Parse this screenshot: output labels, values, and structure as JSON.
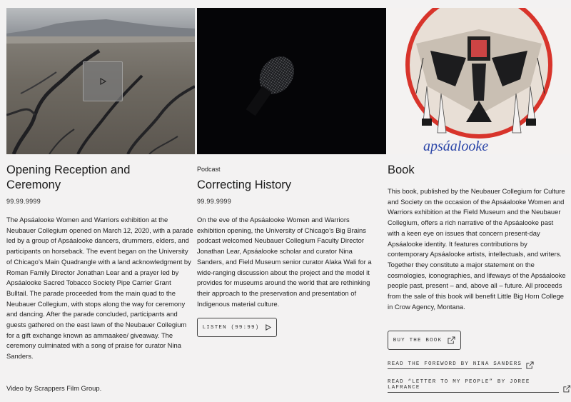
{
  "items": [
    {
      "title": "Opening Reception and Ceremony",
      "date": "99.99.9999",
      "body": "The Apsáalooke Women and Warriors exhibition at the Neubauer Collegium opened on March 12, 2020, with a parade led by a group of Apsáalooke dancers, drummers, elders, and participants on horseback. The event began on the University of Chicago’s Main Quadrangle with a land acknowledgment by Roman Family Director Jonathan Lear and a prayer led by Apsáalooke Sacred Tobacco Society Pipe Carrier Grant Bulltail. The parade proceeded from the main quad to the Neubauer Collegium, with stops along the way for ceremony and dancing. After the parade concluded, participants and guests gathered on the east lawn of the Neubauer Collegium for a gift exchange known as ammaakee/ giveaway. The ceremony culminated with a song of praise for curator Nina Sanders.",
      "credit": "Video by Scrappers Film Group."
    },
    {
      "kicker": "Podcast",
      "title": "Correcting History",
      "date": "99.99.9999",
      "body": "On the eve of the Apsáalooke Women and Warriors exhibition opening, the University of Chicago’s Big Brains podcast welcomed Neubauer Collegium Faculty Director Jonathan Lear, Apsáalooke scholar and curator Nina Sanders, and Field Museum senior curator Alaka Wali for a wide-ranging discussion about the project and the model it provides for museums around the world that are rethinking their approach to the preservation and presentation of Indigenous material culture.",
      "button": "LISTEN (99:99)"
    },
    {
      "title": "Book",
      "body": "This book, published by the Neubauer Collegium for Culture and Society on the occasion of the Apsáalooke Women and Warriors exhibition at the Field Museum and the Neubauer Collegium, offers a rich narrative of the Apsáalooke past with a keen eye on issues that concern present-day Apsáalooke identity. It features contributions by contemporary Apsáalooke artists, intellectuals, and writers. Together they constitute a major statement on the cosmologies, iconographies, and lifeways of the Apsáalooke people past, present – and, above all – future. All proceeds from the sale of this book will benefit Little Big Horn College in Crow Agency, Montana.",
      "button": "BUY THE BOOK",
      "links": [
        "READ THE FOREWORD BY NINA SANDERS",
        "READ “LETTER TO MY PEOPLE” BY JOREE LAFRANCE"
      ],
      "cover_text": "apsáalooke"
    }
  ],
  "colors": {
    "background": "#f3f2f2",
    "text": "#1c1c1c",
    "cover_accent": "#d8342b",
    "cover_blue": "#2a45a8"
  },
  "icons": [
    "play-icon",
    "external-link-icon"
  ]
}
